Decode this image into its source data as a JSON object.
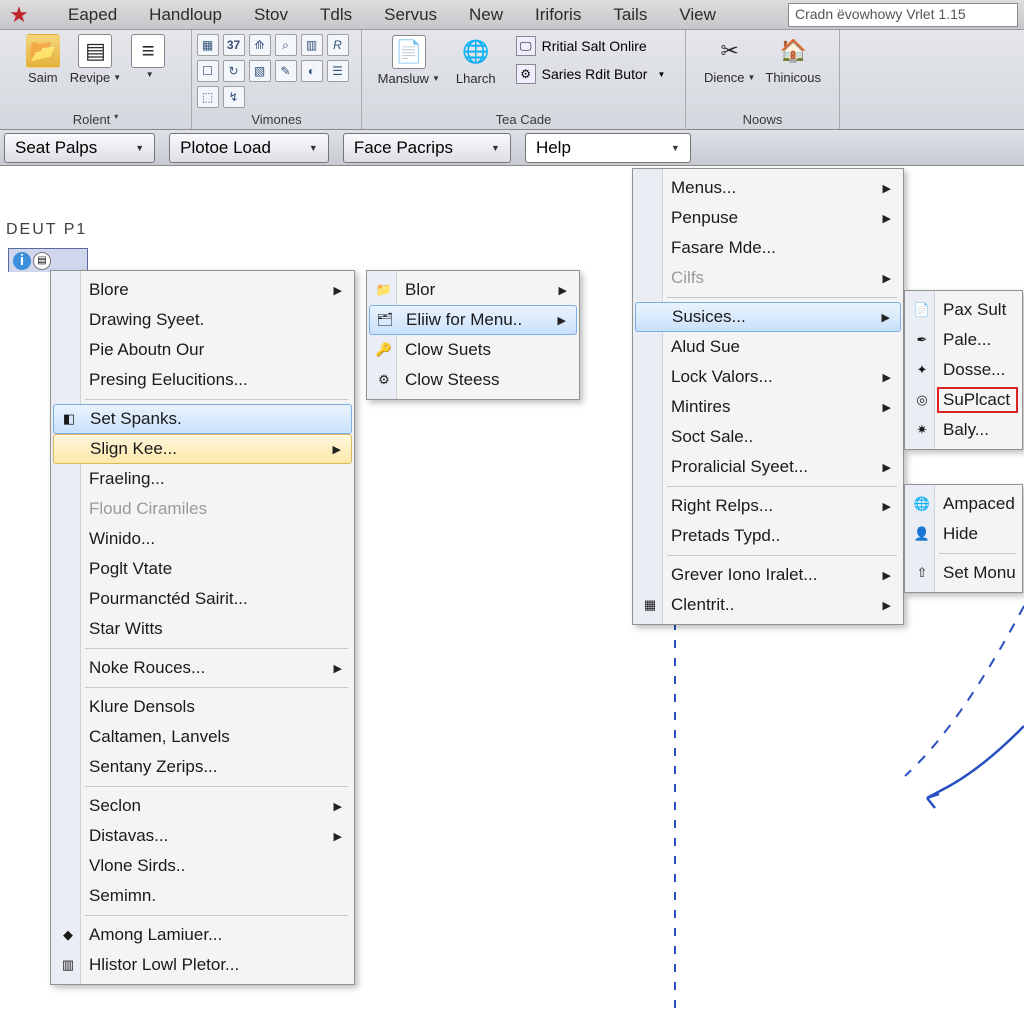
{
  "title_field": "Cradn ëvowhowy Vrlet 1.15",
  "menubar": [
    "Eaped",
    "Handloup",
    "Stov",
    "Tdls",
    "Servus",
    "New",
    "Iriforis",
    "Tails",
    "View"
  ],
  "ribbon": {
    "g1": {
      "items": [
        {
          "label": "Saim"
        },
        {
          "label": "Revipe",
          "drop": true
        },
        {
          "label": "",
          "drop": true
        }
      ],
      "label": "Rolent",
      "drop": true
    },
    "g2": {
      "label": "Vimones"
    },
    "g3": {
      "mid": {
        "label": "Mansluw",
        "drop": true
      },
      "right": [
        {
          "label": "Lharch"
        },
        {
          "label": "Rritial Salt Onlire"
        },
        {
          "label": "Saries Rdit Butor",
          "drop": true
        }
      ],
      "label": "Tea Cade"
    },
    "g4": {
      "items": [
        {
          "label": "Dience",
          "drop": true
        },
        {
          "label": "Thinicous"
        }
      ],
      "label": "Noows"
    }
  },
  "subbar": [
    {
      "label": "Seat Palps"
    },
    {
      "label": "Plotoe Load"
    },
    {
      "label": "Face Pacrips"
    },
    {
      "label": "Help",
      "open": true
    }
  ],
  "ws_label": "DEUT P1",
  "menuA": [
    {
      "t": "Blore",
      "arr": true
    },
    {
      "t": "Drawing Syeet."
    },
    {
      "t": "Pie Aboutn Our"
    },
    {
      "t": "Presing Eelucitions..."
    },
    {
      "sep": true
    },
    {
      "t": "Set Spanks.",
      "hl": "blue",
      "icon": "◧"
    },
    {
      "t": "Slign Kee...",
      "hl": "amber",
      "arr": true
    },
    {
      "t": "Fraeling..."
    },
    {
      "t": "Floud Ciramiles",
      "disabled": true
    },
    {
      "t": "Winido..."
    },
    {
      "t": "Poglt Vtate"
    },
    {
      "t": "Pourmanctéd Sairit..."
    },
    {
      "t": "Star Witts"
    },
    {
      "sep": true
    },
    {
      "t": "Noke Rouces...",
      "arr": true
    },
    {
      "sep": true
    },
    {
      "t": "Klure Densols"
    },
    {
      "t": "Caltamen, Lanvels"
    },
    {
      "t": "Sentany Zerips..."
    },
    {
      "sep": true
    },
    {
      "t": "Seclon",
      "arr": true
    },
    {
      "t": "Distavas...",
      "arr": true
    },
    {
      "t": "Vlone Sirds.."
    },
    {
      "t": "Semimn."
    },
    {
      "sep": true
    },
    {
      "t": "Among Lamiuer...",
      "icon": "◆"
    },
    {
      "t": "Hlistor Lowl Pletor...",
      "icon": "▥"
    }
  ],
  "menuB": [
    {
      "t": "Blor",
      "arr": true,
      "icon": "📁"
    },
    {
      "t": "Eliiw for Menu..",
      "arr": true,
      "hl": "blue",
      "icon": "🗂"
    },
    {
      "t": "Clow Suets",
      "icon": "🔑"
    },
    {
      "t": "Clow Steess",
      "icon": "⚙"
    }
  ],
  "menuC": [
    {
      "t": "Menus...",
      "arr": true
    },
    {
      "t": "Penpuse",
      "arr": true
    },
    {
      "t": "Fasare Mde..."
    },
    {
      "t": "Cilfs",
      "arr": true,
      "disabled": true
    },
    {
      "sep": true
    },
    {
      "t": "Susices...",
      "arr": true,
      "hl": "blue"
    },
    {
      "t": "Alud Sue"
    },
    {
      "t": "Lock Valors...",
      "arr": true
    },
    {
      "t": "Mintires",
      "arr": true
    },
    {
      "t": "Soct Sale.."
    },
    {
      "t": "Proralicial Syeet...",
      "arr": true
    },
    {
      "sep": true
    },
    {
      "t": "Right Relps...",
      "arr": true
    },
    {
      "t": "Pretads Typd.."
    },
    {
      "sep": true
    },
    {
      "t": "Grever Iono Iralet...",
      "arr": true
    },
    {
      "t": "Clentrit..",
      "arr": true,
      "icon": "▦"
    }
  ],
  "menuD": [
    {
      "t": "Pax Sult",
      "icon": "📄"
    },
    {
      "t": "Pale...",
      "icon": "✒"
    },
    {
      "t": "Dosse...",
      "icon": "✦"
    },
    {
      "t": "SuPlcact",
      "icon": "◎",
      "red": true
    },
    {
      "t": "Baly...",
      "icon": "✷"
    }
  ],
  "menuE": [
    {
      "t": "Ampaced",
      "icon": "🌐"
    },
    {
      "t": "Hide",
      "icon": "👤"
    },
    {
      "sep": true
    },
    {
      "t": "Set Monu",
      "icon": "⇧"
    }
  ]
}
